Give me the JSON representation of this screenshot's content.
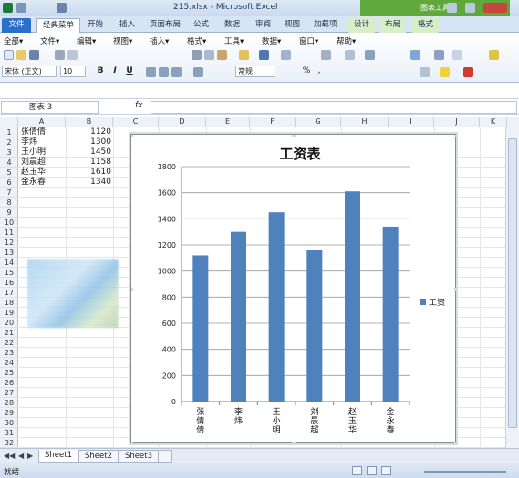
{
  "window": {
    "title": "215.xlsx - Microsoft Excel",
    "contextual_title": "图表工具"
  },
  "tabs": [
    {
      "label": "文件"
    },
    {
      "label": "经典菜单"
    },
    {
      "label": "开始"
    },
    {
      "label": "插入"
    },
    {
      "label": "页面布局"
    },
    {
      "label": "公式"
    },
    {
      "label": "数据"
    },
    {
      "label": "审阅"
    },
    {
      "label": "视图"
    },
    {
      "label": "加载项"
    },
    {
      "label": "设计"
    },
    {
      "label": "布局"
    },
    {
      "label": "格式"
    }
  ],
  "menu": [
    "全部▾",
    "文件▾",
    "编辑▾",
    "视图▾",
    "插入▾",
    "格式▾",
    "工具▾",
    "数据▾",
    "窗口▾",
    "帮助▾"
  ],
  "ribbon": {
    "font_name": "宋体 (正文)",
    "font_size": "10",
    "bold": "B",
    "italic": "I",
    "underline": "U",
    "number_format": "常规",
    "percent": "%",
    "comma": ","
  },
  "formula_bar": {
    "name_box": "图表 3",
    "fx": "fx",
    "formula": ""
  },
  "columns": [
    "A",
    "B",
    "C",
    "D",
    "E",
    "F",
    "G",
    "H",
    "I",
    "J",
    "K"
  ],
  "rows": [
    "1",
    "2",
    "3",
    "4",
    "5",
    "6",
    "7",
    "8",
    "9",
    "10",
    "11",
    "12",
    "13",
    "14",
    "15",
    "16",
    "17",
    "18",
    "19",
    "20",
    "21",
    "22",
    "23",
    "24",
    "25",
    "26",
    "27",
    "28",
    "29",
    "30",
    "31",
    "32"
  ],
  "cells": [
    {
      "name": "张倩倩",
      "salary": "1120"
    },
    {
      "name": "李炜",
      "salary": "1300"
    },
    {
      "name": "王小明",
      "salary": "1450"
    },
    {
      "name": "刘晨超",
      "salary": "1158"
    },
    {
      "name": "赵玉华",
      "salary": "1610"
    },
    {
      "name": "金永春",
      "salary": "1340"
    }
  ],
  "chart_data": {
    "type": "bar",
    "title": "工资表",
    "categories": [
      "张倩倩",
      "李炜",
      "王小明",
      "刘晨超",
      "赵玉华",
      "金永春"
    ],
    "series": [
      {
        "name": "工资",
        "values": [
          1120,
          1300,
          1450,
          1158,
          1610,
          1340
        ],
        "color": "#4f81bd"
      }
    ],
    "ylim": [
      0,
      1800
    ],
    "yticks": [
      0,
      200,
      400,
      600,
      800,
      1000,
      1200,
      1400,
      1600,
      1800
    ],
    "grid": true,
    "legend": "right"
  },
  "sheets": [
    {
      "label": "Sheet1"
    },
    {
      "label": "Sheet2"
    },
    {
      "label": "Sheet3"
    }
  ],
  "status": {
    "ready": "就绪"
  }
}
